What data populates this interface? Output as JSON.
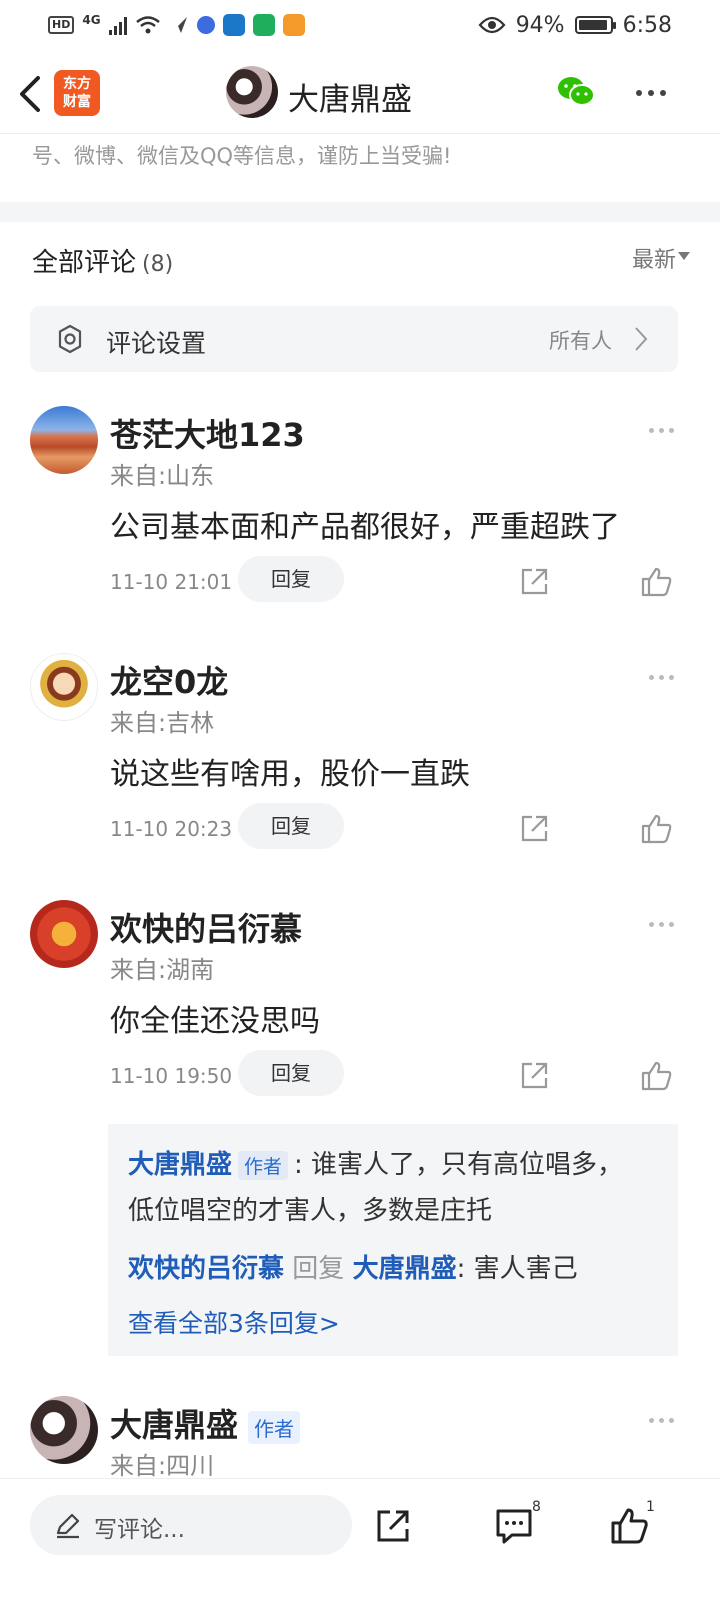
{
  "status_bar": {
    "hd": "HD",
    "network": "4G",
    "battery_pct": "94%",
    "battery_level": 0.94,
    "time": "6:58"
  },
  "header": {
    "logo_line1": "东方",
    "logo_line2": "财富",
    "title": "大唐鼎盛"
  },
  "notice": "号、微博、微信及QQ等信息，谨防上当受骗!",
  "comments_section": {
    "title": "全部评论",
    "count": "(8)",
    "sort_label": "最新"
  },
  "settings": {
    "label": "评论设置",
    "value": "所有人"
  },
  "comments": [
    {
      "name": "苍茫大地123",
      "location": "来自:山东",
      "text": "公司基本面和产品都很好，严重超跌了",
      "time": "11-10 21:01",
      "reply_label": "回复"
    },
    {
      "name": "龙空0龙",
      "location": "来自:吉林",
      "text": "说这些有啥用，股价一直跌",
      "time": "11-10 20:23",
      "reply_label": "回复"
    },
    {
      "name": "欢快的吕衍慕",
      "location": "来自:湖南",
      "text": "你全佳还没思吗",
      "time": "11-10 19:50",
      "reply_label": "回复"
    },
    {
      "name": "大唐鼎盛",
      "author_tag": "作者",
      "location": "来自:四川"
    }
  ],
  "reply_thread": {
    "r1_author": "大唐鼎盛",
    "r1_tag": "作者",
    "r1_text_a": ": 谁害人了，只有高位唱多，",
    "r1_text_b": "低位唱空的才害人，多数是庄托",
    "r2_author": "欢快的吕衍慕",
    "r2_mid": "回复",
    "r2_target": "大唐鼎盛",
    "r2_text": ": 害人害己",
    "view_all": "查看全部3条回复>"
  },
  "bottom_bar": {
    "input_placeholder": "写评论...",
    "comment_count": "8",
    "like_count": "1"
  },
  "colors": {
    "brand_orange": "#f05a22",
    "link_blue": "#1f5db8",
    "wechat_green": "#2dc100"
  },
  "icons": [
    "back-icon",
    "wechat-icon",
    "more-icon",
    "gear-icon",
    "chevron-right-icon",
    "share-icon",
    "like-icon",
    "pen-icon",
    "comment-icon"
  ]
}
